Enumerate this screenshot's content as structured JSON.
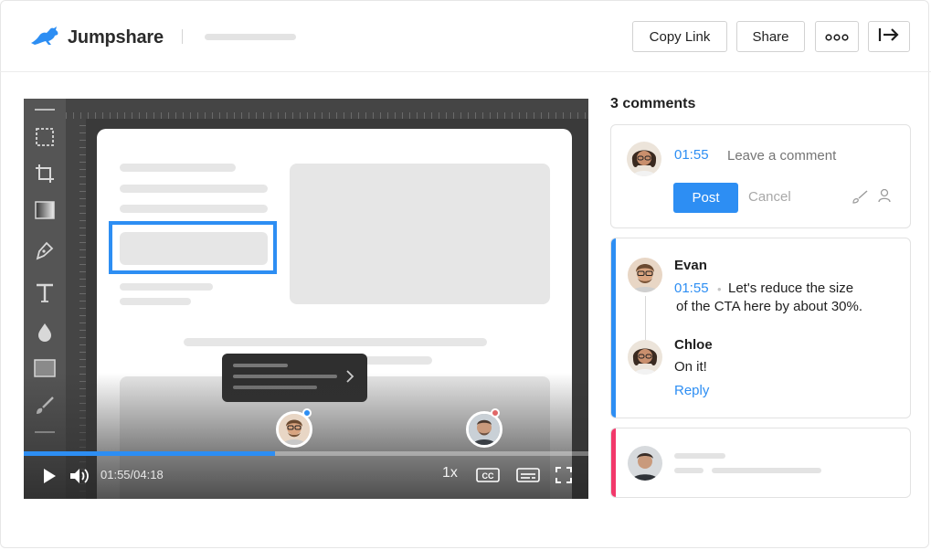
{
  "app": {
    "name": "Jumpshare"
  },
  "header": {
    "copy_link_label": "Copy Link",
    "share_label": "Share"
  },
  "player": {
    "current_time": "01:55",
    "total_time": "04:18",
    "time_display": "01:55/04:18",
    "progress_fraction": 0.4457,
    "speed": "1x",
    "cc_label": "CC"
  },
  "comments": {
    "count_label": "3 comments",
    "composer": {
      "timestamp": "01:55",
      "placeholder": "Leave a comment",
      "post_label": "Post",
      "cancel_label": "Cancel"
    },
    "thread": [
      {
        "author": "Evan",
        "timestamp": "01:55",
        "text_line1": "Let's reduce the size",
        "text_line2": "of the CTA here by about 30%."
      },
      {
        "author": "Chloe",
        "text": "On it!"
      }
    ],
    "reply_label": "Reply"
  },
  "colors": {
    "accent_blue": "#2d8ef3",
    "accent_pink": "#f2386a",
    "dot_red": "#e06767"
  }
}
